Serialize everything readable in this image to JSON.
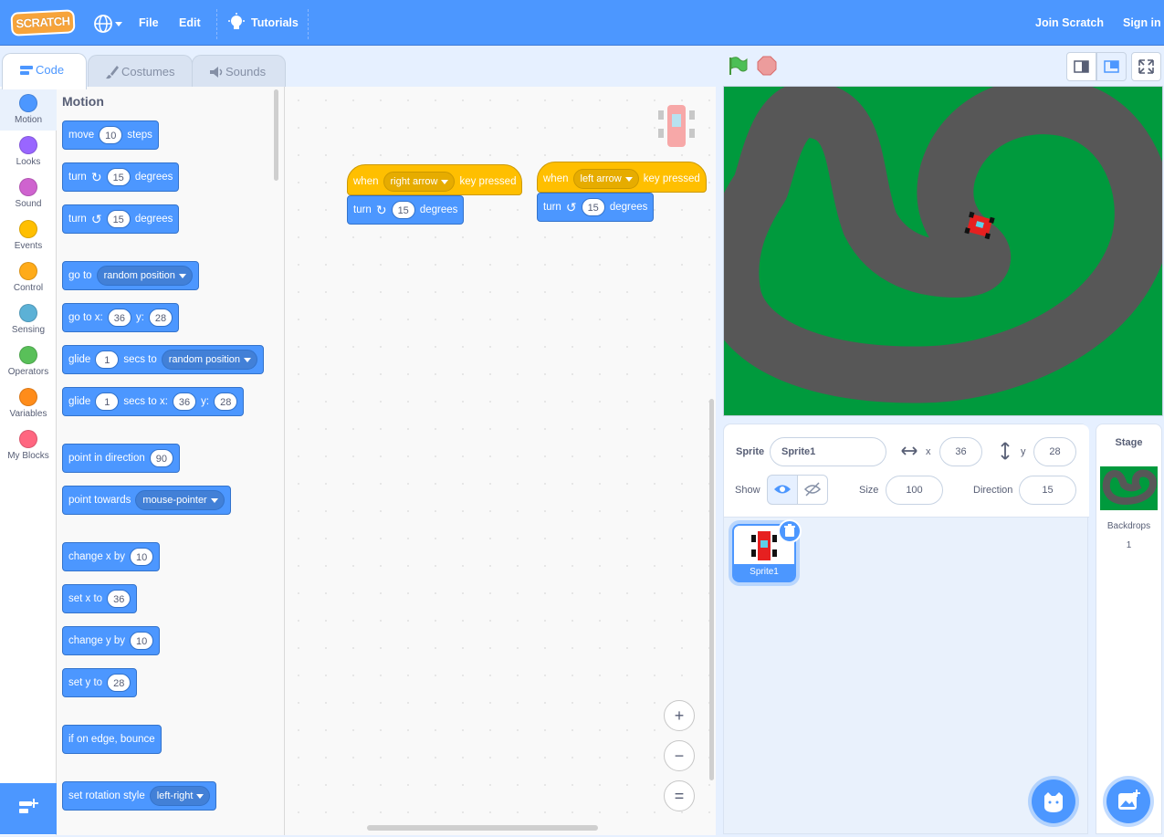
{
  "menubar": {
    "logo_text": "SCRATCH",
    "file": "File",
    "edit": "Edit",
    "tutorials": "Tutorials",
    "join": "Join Scratch",
    "signin": "Sign in"
  },
  "tabs": {
    "code": "Code",
    "costumes": "Costumes",
    "sounds": "Sounds"
  },
  "categories": [
    {
      "label": "Motion",
      "color": "#4c97ff"
    },
    {
      "label": "Looks",
      "color": "#9966ff"
    },
    {
      "label": "Sound",
      "color": "#cf63cf"
    },
    {
      "label": "Events",
      "color": "#ffbf00"
    },
    {
      "label": "Control",
      "color": "#ffab19"
    },
    {
      "label": "Sensing",
      "color": "#5cb1d6"
    },
    {
      "label": "Operators",
      "color": "#59c059"
    },
    {
      "label": "Variables",
      "color": "#ff8c1a"
    },
    {
      "label": "My Blocks",
      "color": "#ff6680"
    }
  ],
  "palette": {
    "title": "Motion",
    "move": {
      "a": "move",
      "v": "10",
      "b": "steps"
    },
    "turn_right": {
      "a": "turn",
      "v": "15",
      "b": "degrees"
    },
    "turn_left": {
      "a": "turn",
      "v": "15",
      "b": "degrees"
    },
    "goto": {
      "a": "go to",
      "dd": "random position"
    },
    "gotoxy": {
      "a": "go to x:",
      "x": "36",
      "b": "y:",
      "y": "28"
    },
    "glide": {
      "a": "glide",
      "v": "1",
      "b": "secs to",
      "dd": "random position"
    },
    "glidexy": {
      "a": "glide",
      "v": "1",
      "b": "secs to x:",
      "x": "36",
      "c": "y:",
      "y": "28"
    },
    "point": {
      "a": "point in direction",
      "v": "90"
    },
    "towards": {
      "a": "point towards",
      "dd": "mouse-pointer"
    },
    "changex": {
      "a": "change x by",
      "v": "10"
    },
    "setx": {
      "a": "set x to",
      "v": "36"
    },
    "changey": {
      "a": "change y by",
      "v": "10"
    },
    "sety": {
      "a": "set y to",
      "v": "28"
    },
    "bounce": {
      "a": "if on edge, bounce"
    },
    "rotstyle": {
      "a": "set rotation style",
      "dd": "left-right"
    }
  },
  "scripts": [
    {
      "when": "when",
      "key": "right arrow",
      "pressed": "key pressed",
      "turn": "turn",
      "deg_value": "15",
      "deg": "degrees"
    },
    {
      "when": "when",
      "key": "left arrow",
      "pressed": "key pressed",
      "turn": "turn",
      "deg_value": "15",
      "deg": "degrees"
    }
  ],
  "zoom": {
    "in": "+",
    "out": "−",
    "reset": "="
  },
  "sprite_info": {
    "sprite_label": "Sprite",
    "sprite_name": "Sprite1",
    "x_label": "x",
    "x_value": "36",
    "y_label": "y",
    "y_value": "28",
    "show_label": "Show",
    "size_label": "Size",
    "size_value": "100",
    "direction_label": "Direction",
    "direction_value": "15"
  },
  "sprites": [
    {
      "name": "Sprite1"
    }
  ],
  "stage_pane": {
    "title": "Stage",
    "backdrops_label": "Backdrops",
    "backdrops_count": "1"
  },
  "colors": {
    "accent": "#4c97ff",
    "events": "#ffbf00",
    "grass": "#009a3d",
    "track": "#575757"
  }
}
